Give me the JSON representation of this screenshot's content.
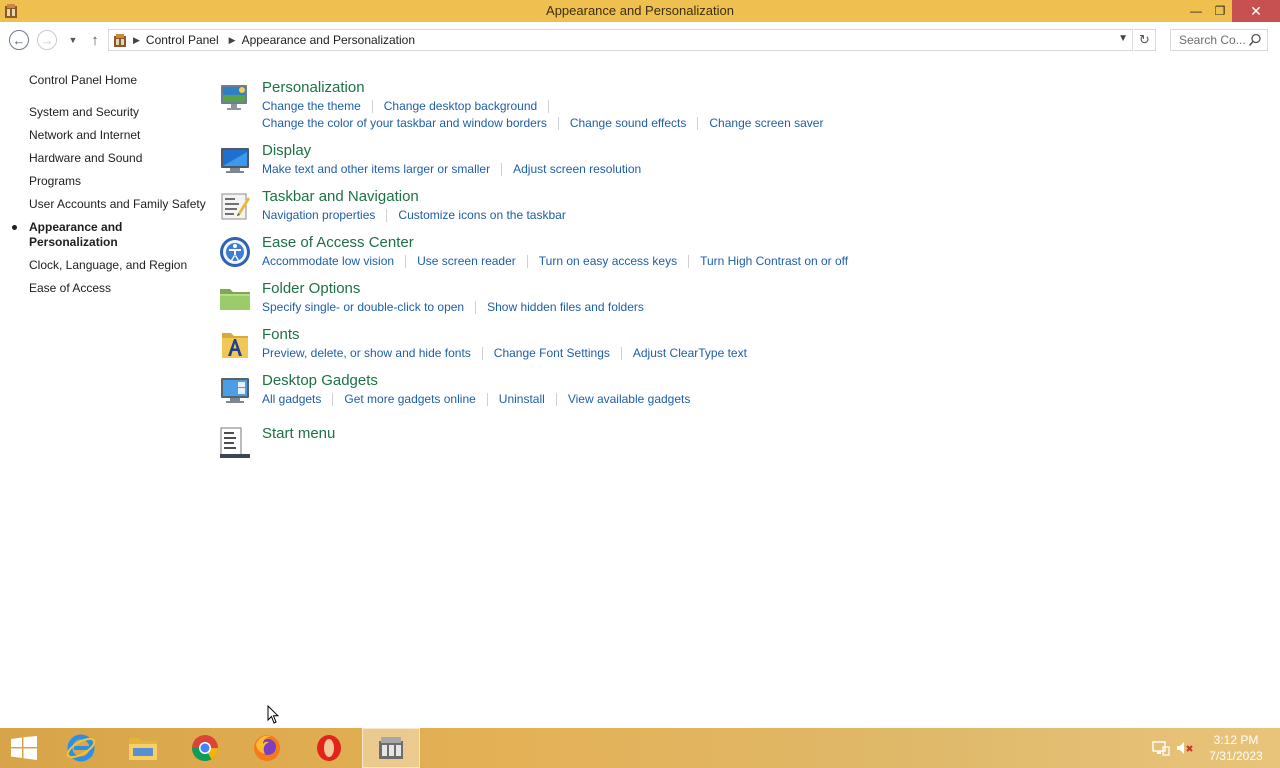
{
  "window": {
    "title": "Appearance and Personalization",
    "minimize_label": "—",
    "maximize_label": "❐",
    "close_label": "✕"
  },
  "address": {
    "crumbs": [
      "Control Panel",
      "Appearance and Personalization"
    ],
    "search_placeholder": "Search Co..."
  },
  "leftnav": {
    "home": "Control Panel Home",
    "items": [
      {
        "label": "System and Security"
      },
      {
        "label": "Network and Internet"
      },
      {
        "label": "Hardware and Sound"
      },
      {
        "label": "Programs"
      },
      {
        "label": "User Accounts and Family Safety"
      },
      {
        "label": "Appearance and Personalization",
        "active": true
      },
      {
        "label": "Clock, Language, and Region"
      },
      {
        "label": "Ease of Access"
      }
    ]
  },
  "categories": [
    {
      "title": "Personalization",
      "icon": "personalization-icon",
      "links": [
        "Change the theme",
        "Change desktop background",
        "Change the color of your taskbar and window borders",
        "Change sound effects",
        "Change screen saver"
      ]
    },
    {
      "title": "Display",
      "icon": "display-icon",
      "links": [
        "Make text and other items larger or smaller",
        "Adjust screen resolution"
      ]
    },
    {
      "title": "Taskbar and Navigation",
      "icon": "taskbar-icon",
      "links": [
        "Navigation properties",
        "Customize icons on the taskbar"
      ]
    },
    {
      "title": "Ease of Access Center",
      "icon": "ease-of-access-icon",
      "links": [
        "Accommodate low vision",
        "Use screen reader",
        "Turn on easy access keys",
        "Turn High Contrast on or off"
      ]
    },
    {
      "title": "Folder Options",
      "icon": "folder-icon",
      "links": [
        "Specify single- or double-click to open",
        "Show hidden files and folders"
      ]
    },
    {
      "title": "Fonts",
      "icon": "fonts-icon",
      "links": [
        "Preview, delete, or show and hide fonts",
        "Change Font Settings",
        "Adjust ClearType text"
      ]
    },
    {
      "title": "Desktop Gadgets",
      "icon": "gadgets-icon",
      "links": [
        "All gadgets",
        "Get more gadgets online",
        "Uninstall",
        "View available gadgets"
      ]
    },
    {
      "title": "Start menu",
      "icon": "start-menu-icon",
      "links": []
    }
  ],
  "taskbar": {
    "apps": [
      "internet-explorer-icon",
      "file-explorer-icon",
      "chrome-icon",
      "firefox-icon",
      "opera-icon",
      "control-panel-icon"
    ],
    "time": "3:12 PM",
    "date": "7/31/2023"
  },
  "colors": {
    "titlebar": "#efc04f",
    "category_title": "#1e7145",
    "link": "#1f5ea8",
    "close_button": "#c75050"
  }
}
